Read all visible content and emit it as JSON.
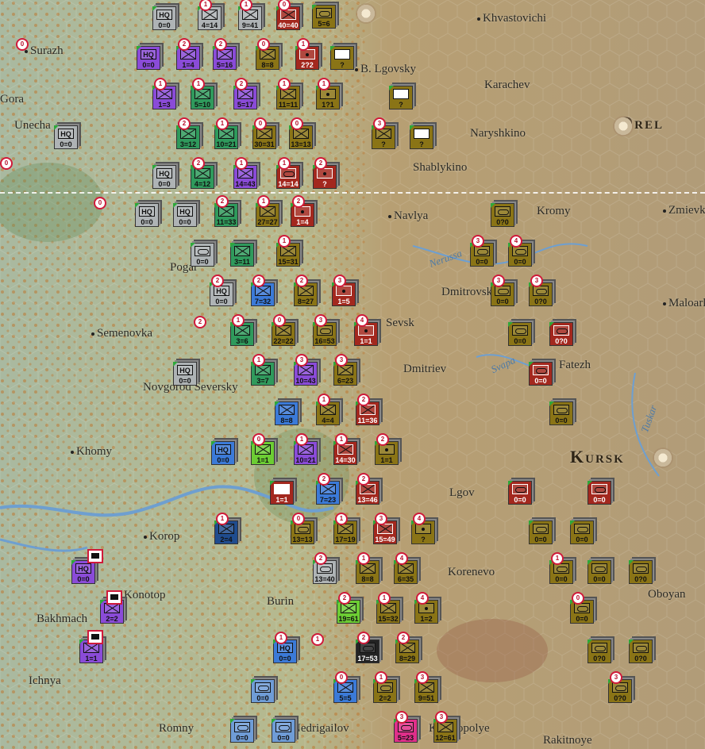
{
  "map": {
    "towns": [
      {
        "name": "Surazh",
        "id": "surazh"
      },
      {
        "name": "Gora",
        "id": "gora"
      },
      {
        "name": "Unecha",
        "id": "unecha"
      },
      {
        "name": "Khvastovichi",
        "id": "khvastovichi"
      },
      {
        "name": "B. Lgovsky",
        "id": "b-lgovsky"
      },
      {
        "name": "Karachev",
        "id": "karachev"
      },
      {
        "name": "Naryshkino",
        "id": "naryshkino"
      },
      {
        "name": "Orel",
        "id": "orel"
      },
      {
        "name": "Shablykino",
        "id": "shablykino"
      },
      {
        "name": "Navlya",
        "id": "navlya"
      },
      {
        "name": "Kromy",
        "id": "kromy"
      },
      {
        "name": "Zmievka",
        "id": "zmievka"
      },
      {
        "name": "Pogar",
        "id": "pogar"
      },
      {
        "name": "Dmitrovsk",
        "id": "dmitrovsk"
      },
      {
        "name": "Maloarkhangelsk",
        "id": "maloarkhangelsk"
      },
      {
        "name": "Semenovka",
        "id": "semenovka"
      },
      {
        "name": "Sevsk",
        "id": "sevsk"
      },
      {
        "name": "Fatezh",
        "id": "fatezh"
      },
      {
        "name": "Dmitriev",
        "id": "dmitriev"
      },
      {
        "name": "Novgorod Seversky",
        "id": "novgorod-seversky"
      },
      {
        "name": "Lgov",
        "id": "lgov"
      },
      {
        "name": "Khomy",
        "id": "khomy"
      },
      {
        "name": "Kursk",
        "id": "kursk"
      },
      {
        "name": "Korop",
        "id": "korop"
      },
      {
        "name": "Konotop",
        "id": "konotop"
      },
      {
        "name": "Korenevo",
        "id": "korenevo"
      },
      {
        "name": "Oboyan",
        "id": "oboyan"
      },
      {
        "name": "Bakhmach",
        "id": "bakhmach"
      },
      {
        "name": "Burin",
        "id": "burin"
      },
      {
        "name": "Ichnya",
        "id": "ichnya"
      },
      {
        "name": "Romny",
        "id": "romny"
      },
      {
        "name": "Nedrigailov",
        "id": "nedrigailov"
      },
      {
        "name": "Krasnopolye",
        "id": "krasnopolye"
      },
      {
        "name": "Rakitnoye",
        "id": "rakitnoye"
      }
    ],
    "rivers": [
      {
        "name": "Nerussa"
      },
      {
        "name": "Svapa"
      },
      {
        "name": "Tuskar"
      }
    ]
  },
  "counters": [
    {
      "str": "0=0",
      "c": "gray",
      "sym": "hq"
    },
    {
      "str": "4=14",
      "c": "gray",
      "sym": "inf",
      "badge": "1"
    },
    {
      "str": "9=41",
      "c": "gray",
      "sym": "inf",
      "badge": "1"
    },
    {
      "str": "40=40",
      "c": "red",
      "sym": "inf",
      "badge": "0"
    },
    {
      "str": "5=6",
      "c": "olive",
      "sym": "arm"
    },
    {
      "str": "0=0",
      "c": "purple",
      "sym": "hq"
    },
    {
      "str": "1=4",
      "c": "purple",
      "sym": "inf",
      "badge": "2"
    },
    {
      "str": "5=16",
      "c": "purple",
      "sym": "inf",
      "badge": "2"
    },
    {
      "str": "8=8",
      "c": "olive",
      "sym": "inf",
      "badge": "0"
    },
    {
      "str": "2?2",
      "c": "red",
      "sym": "art",
      "badge": "1"
    },
    {
      "str": "?",
      "c": "olive",
      "sym": "unk"
    },
    {
      "str": "1=3",
      "c": "purple",
      "sym": "inf",
      "badge": "1"
    },
    {
      "str": "5=10",
      "c": "green",
      "sym": "inf",
      "badge": "1"
    },
    {
      "str": "5=17",
      "c": "purple",
      "sym": "inf",
      "badge": "2"
    },
    {
      "str": "11=11",
      "c": "olive",
      "sym": "inf",
      "badge": "1"
    },
    {
      "str": "1?1",
      "c": "olive",
      "sym": "art",
      "badge": "1"
    },
    {
      "str": "?",
      "c": "olive",
      "sym": "unk"
    },
    {
      "str": "0=0",
      "c": "gray",
      "sym": "hq"
    },
    {
      "str": "3=12",
      "c": "green",
      "sym": "inf",
      "badge": "2"
    },
    {
      "str": "10=21",
      "c": "green",
      "sym": "inf",
      "badge": "1"
    },
    {
      "str": "30=31",
      "c": "olive",
      "sym": "inf",
      "badge": "0"
    },
    {
      "str": "13=13",
      "c": "olive",
      "sym": "inf",
      "badge": "0"
    },
    {
      "str": "?",
      "c": "olive",
      "sym": "inf",
      "badge": "3"
    },
    {
      "str": "?",
      "c": "olive",
      "sym": "unk"
    },
    {
      "str": "0=0",
      "c": "gray",
      "sym": "hq"
    },
    {
      "str": "4=12",
      "c": "green",
      "sym": "inf",
      "badge": "2"
    },
    {
      "str": "14=43",
      "c": "purple",
      "sym": "inf",
      "badge": "1"
    },
    {
      "str": "14=14",
      "c": "red",
      "sym": "arm",
      "badge": "1"
    },
    {
      "str": "?",
      "c": "red",
      "sym": "art",
      "badge": "2"
    },
    {
      "str": "0=0",
      "c": "gray",
      "sym": "hq"
    },
    {
      "str": "0=0",
      "c": "gray",
      "sym": "hq"
    },
    {
      "str": "11=33",
      "c": "green",
      "sym": "inf",
      "badge": "2"
    },
    {
      "str": "27=27",
      "c": "olive",
      "sym": "inf",
      "badge": "1"
    },
    {
      "str": "1=4",
      "c": "red",
      "sym": "art",
      "badge": "2"
    },
    {
      "str": "0?0",
      "c": "olive",
      "sym": "arm"
    },
    {
      "str": "0=0",
      "c": "gray",
      "sym": "arm"
    },
    {
      "str": "3=11",
      "c": "green",
      "sym": "inf"
    },
    {
      "str": "15=31",
      "c": "olive",
      "sym": "inf",
      "badge": "1"
    },
    {
      "str": "0=0",
      "c": "olive",
      "sym": "arm",
      "badge": "3"
    },
    {
      "str": "0=0",
      "c": "olive",
      "sym": "arm",
      "badge": "4"
    },
    {
      "str": "0=0",
      "c": "gray",
      "sym": "hq",
      "badge": "2"
    },
    {
      "str": "7=32",
      "c": "blue",
      "sym": "inf",
      "badge": "2"
    },
    {
      "str": "8=27",
      "c": "olive",
      "sym": "inf",
      "badge": "2"
    },
    {
      "str": "1=5",
      "c": "red",
      "sym": "art",
      "badge": "3"
    },
    {
      "str": "0=0",
      "c": "olive",
      "sym": "arm",
      "badge": "3"
    },
    {
      "str": "0?0",
      "c": "olive",
      "sym": "arm",
      "badge": "3"
    },
    {
      "str": "3=6",
      "c": "green",
      "sym": "inf",
      "badge": "1"
    },
    {
      "str": "22=22",
      "c": "olive",
      "sym": "inf",
      "badge": "0"
    },
    {
      "str": "16=53",
      "c": "olive",
      "sym": "arm",
      "badge": "3"
    },
    {
      "str": "1=1",
      "c": "red",
      "sym": "art",
      "badge": "4"
    },
    {
      "str": "0=0",
      "c": "olive",
      "sym": "arm"
    },
    {
      "str": "0?0",
      "c": "red",
      "sym": "arm"
    },
    {
      "str": "0=0",
      "c": "gray",
      "sym": "hq"
    },
    {
      "str": "3=7",
      "c": "green",
      "sym": "inf",
      "badge": "1"
    },
    {
      "str": "10=43",
      "c": "purple",
      "sym": "inf",
      "badge": "3"
    },
    {
      "str": "6=23",
      "c": "olive",
      "sym": "inf",
      "badge": "3"
    },
    {
      "str": "0=0",
      "c": "red",
      "sym": "arm"
    },
    {
      "str": "8=8",
      "c": "blue",
      "sym": "inf"
    },
    {
      "str": "4=4",
      "c": "olive",
      "sym": "inf",
      "badge": "1"
    },
    {
      "str": "11=36",
      "c": "red",
      "sym": "inf",
      "badge": "2"
    },
    {
      "str": "0=0",
      "c": "olive",
      "sym": "arm"
    },
    {
      "str": "0=0",
      "c": "blue",
      "sym": "hq"
    },
    {
      "str": "1=1",
      "c": "lime",
      "sym": "inf",
      "badge": "0"
    },
    {
      "str": "10=21",
      "c": "purple",
      "sym": "inf",
      "badge": "1"
    },
    {
      "str": "14=30",
      "c": "red",
      "sym": "inf",
      "badge": "1"
    },
    {
      "str": "1=1",
      "c": "olive",
      "sym": "art",
      "badge": "2"
    },
    {
      "str": "1=1",
      "c": "red",
      "sym": "unk"
    },
    {
      "str": "7=23",
      "c": "blue",
      "sym": "inf",
      "badge": "2"
    },
    {
      "str": "13=46",
      "c": "red",
      "sym": "inf",
      "badge": "2"
    },
    {
      "str": "0=0",
      "c": "red",
      "sym": "arm"
    },
    {
      "str": "0=0",
      "c": "red",
      "sym": "arm"
    },
    {
      "str": "2=4",
      "c": "dblue",
      "sym": "inf",
      "badge": "1"
    },
    {
      "str": "13=13",
      "c": "olive",
      "sym": "arm",
      "badge": "0"
    },
    {
      "str": "17=19",
      "c": "olive",
      "sym": "inf",
      "badge": "1"
    },
    {
      "str": "15=49",
      "c": "red",
      "sym": "inf",
      "badge": "3"
    },
    {
      "str": "?",
      "c": "olive",
      "sym": "art",
      "badge": "4"
    },
    {
      "str": "0=0",
      "c": "olive",
      "sym": "arm"
    },
    {
      "str": "0=0",
      "c": "olive",
      "sym": "arm"
    },
    {
      "str": "0=0",
      "c": "purple",
      "sym": "hq"
    },
    {
      "str": "13=40",
      "c": "gray",
      "sym": "arm",
      "badge": "2"
    },
    {
      "str": "8=8",
      "c": "olive",
      "sym": "inf",
      "badge": "1"
    },
    {
      "str": "6=35",
      "c": "olive",
      "sym": "inf",
      "badge": "4"
    },
    {
      "str": "0=0",
      "c": "olive",
      "sym": "arm",
      "badge": "1"
    },
    {
      "str": "0=0",
      "c": "olive",
      "sym": "arm"
    },
    {
      "str": "0?0",
      "c": "olive",
      "sym": "arm"
    },
    {
      "str": "2=2",
      "c": "purple",
      "sym": "inf"
    },
    {
      "str": "19=61",
      "c": "lime",
      "sym": "inf",
      "badge": "2"
    },
    {
      "str": "15=32",
      "c": "olive",
      "sym": "inf",
      "badge": "1"
    },
    {
      "str": "1=2",
      "c": "olive",
      "sym": "art",
      "badge": "4"
    },
    {
      "str": "0=0",
      "c": "olive",
      "sym": "arm",
      "badge": "0"
    },
    {
      "str": "1=1",
      "c": "purple",
      "sym": "inf"
    },
    {
      "str": "0=0",
      "c": "blue",
      "sym": "hq",
      "badge": "1"
    },
    {
      "str": "17=53",
      "c": "dark",
      "sym": "arm",
      "badge": "2"
    },
    {
      "str": "8=29",
      "c": "olive",
      "sym": "inf",
      "badge": "2"
    },
    {
      "str": "0?0",
      "c": "olive",
      "sym": "arm"
    },
    {
      "str": "0?0",
      "c": "olive",
      "sym": "arm"
    },
    {
      "str": "0=0",
      "c": "ltblue",
      "sym": "arm"
    },
    {
      "str": "5=5",
      "c": "blue",
      "sym": "inf",
      "badge": "0"
    },
    {
      "str": "2=2",
      "c": "olive",
      "sym": "arm",
      "badge": "1"
    },
    {
      "str": "9=51",
      "c": "olive",
      "sym": "inf",
      "badge": "3"
    },
    {
      "str": "0?0",
      "c": "olive",
      "sym": "arm",
      "badge": "3"
    },
    {
      "str": "0=0",
      "c": "ltblue",
      "sym": "arm"
    },
    {
      "str": "0=0",
      "c": "ltblue",
      "sym": "arm"
    },
    {
      "str": "5=23",
      "c": "pink",
      "sym": "arm",
      "badge": "3"
    },
    {
      "str": "12=61",
      "c": "olive",
      "sym": "inf",
      "badge": "3"
    }
  ],
  "lone_badges": [
    "0",
    "0",
    "0",
    "2",
    "1"
  ],
  "trains": [
    "train-1",
    "train-2",
    "train-3"
  ]
}
